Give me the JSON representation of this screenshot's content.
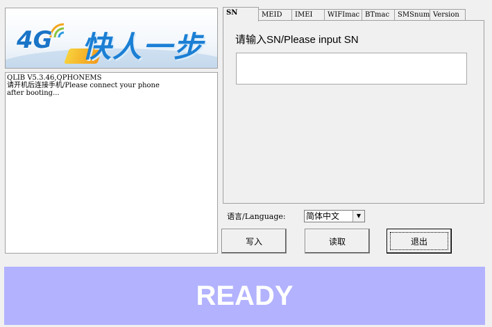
{
  "banner": {
    "logo_text": "4G",
    "slogan": "快人一步"
  },
  "log": {
    "lines": [
      "QLIB V5.3.46,QPHONEMS",
      "请开机后连接手机/Please connect your phone",
      "after booting..."
    ]
  },
  "tabs": [
    {
      "label": "SN",
      "active": true
    },
    {
      "label": "MEID"
    },
    {
      "label": "IMEI"
    },
    {
      "label": "WIFImac"
    },
    {
      "label": "BTmac"
    },
    {
      "label": "SMSnum"
    },
    {
      "label": "Version"
    }
  ],
  "sn_panel": {
    "prompt": "请输入SN/Please input SN",
    "input_value": ""
  },
  "language": {
    "label": "语言/Language:",
    "selected": "简体中文"
  },
  "buttons": {
    "write": "写入",
    "read": "读取",
    "exit": "退出"
  },
  "status": {
    "text": "READY",
    "bg_color": "#b2b2ff"
  }
}
